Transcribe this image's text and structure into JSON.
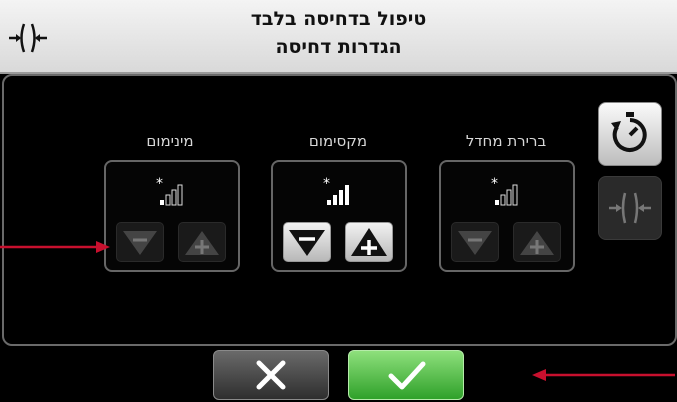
{
  "header": {
    "title_line1": "טיפול בדחיסה בלבד",
    "title_line2": "הגדרות דחיסה",
    "icon": "compression-icon"
  },
  "settings": [
    {
      "id": "default",
      "label": "ברירת מחדל",
      "icon": "signal-strength-icon",
      "enabled": false
    },
    {
      "id": "maximum",
      "label": "מקסימום",
      "icon": "signal-strength-icon",
      "enabled": true
    },
    {
      "id": "minimum",
      "label": "מינימום",
      "icon": "signal-strength-icon",
      "enabled": false
    }
  ],
  "side_buttons": [
    {
      "icon": "timer-reset-icon",
      "enabled": true
    },
    {
      "icon": "compression-icon",
      "enabled": false
    }
  ],
  "footer": {
    "cancel_icon": "x-icon",
    "confirm_icon": "checkmark-icon"
  },
  "colors": {
    "annotation_arrow": "#c8102e",
    "confirm_green": "#3cb034",
    "background": "#000000"
  }
}
